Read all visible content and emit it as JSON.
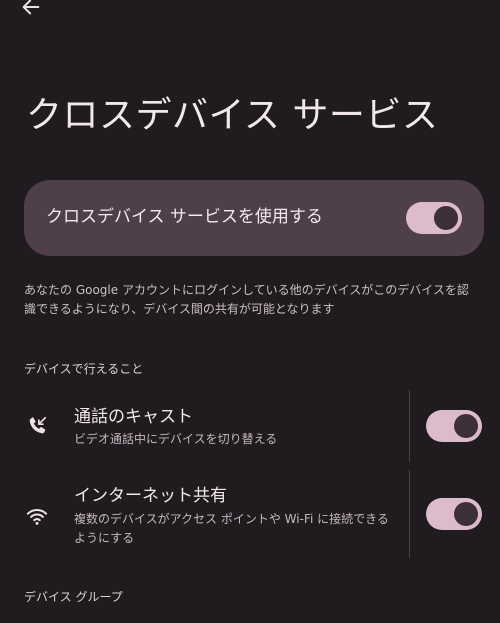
{
  "header": {
    "back_icon": "arrow-back-icon",
    "title": "クロスデバイス サービス"
  },
  "master_toggle": {
    "label": "クロスデバイス サービスを使用する",
    "checked": true
  },
  "description": "あなたの Google アカウントにログインしている他のデバイスがこのデバイスを認識できるようになり、デバイス間の共有が可能となります",
  "sections": {
    "capabilities_header": "デバイスで行えること",
    "device_group_header": "デバイス グループ"
  },
  "items": [
    {
      "title": "通話のキャスト",
      "subtitle": "ビデオ通話中にデバイスを切り替える",
      "icon": "phone-forwarded-icon",
      "checked": true
    },
    {
      "title": "インターネット共有",
      "subtitle": "複数のデバイスがアクセス ポイントや Wi-Fi に接続できるようにする",
      "icon": "wifi-icon",
      "checked": true
    }
  ],
  "colors": {
    "background": "#201b1f",
    "card": "#4f3f48",
    "switch_track": "#dcbccb",
    "switch_thumb": "#3c2f36"
  }
}
